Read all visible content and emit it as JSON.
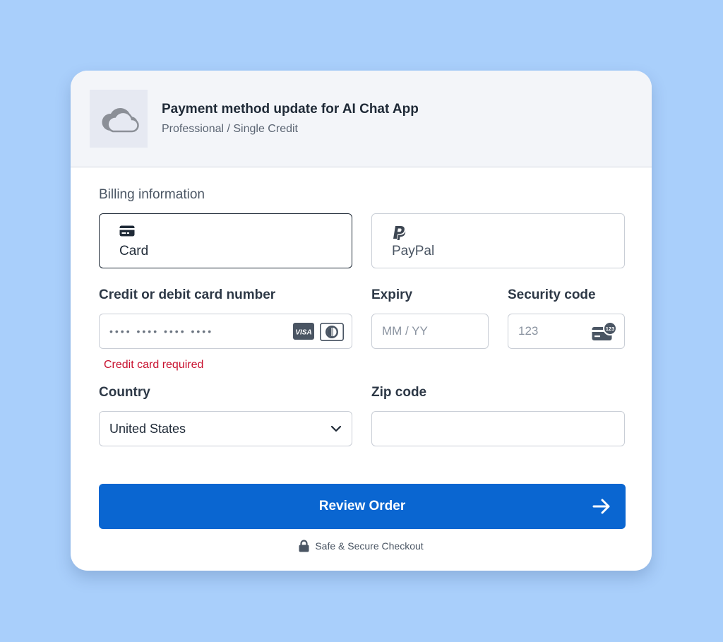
{
  "header": {
    "logo_icon": "cloud-icon",
    "title": "Payment method update for AI Chat App",
    "subtitle": "Professional / Single Credit"
  },
  "billing": {
    "section_title": "Billing information",
    "methods": [
      {
        "label": "Card",
        "icon": "credit-card-icon",
        "selected": true
      },
      {
        "label": "PayPal",
        "icon": "paypal-icon",
        "selected": false
      }
    ]
  },
  "form": {
    "card_number": {
      "label": "Credit or debit card number",
      "placeholder": "•••• •••• •••• ••••",
      "brands": [
        "VISA",
        "diners-club-icon"
      ],
      "error": "Credit card required"
    },
    "expiry": {
      "label": "Expiry",
      "placeholder": "MM / YY"
    },
    "security_code": {
      "label": "Security code",
      "placeholder": "123",
      "badge": "123"
    },
    "country": {
      "label": "Country",
      "value": "United States"
    },
    "zip": {
      "label": "Zip code",
      "value": ""
    }
  },
  "actions": {
    "review_label": "Review Order",
    "secure_text": "Safe & Secure Checkout"
  },
  "colors": {
    "background": "#a9cffb",
    "primary": "#0a66d1",
    "error": "#c8102e"
  }
}
